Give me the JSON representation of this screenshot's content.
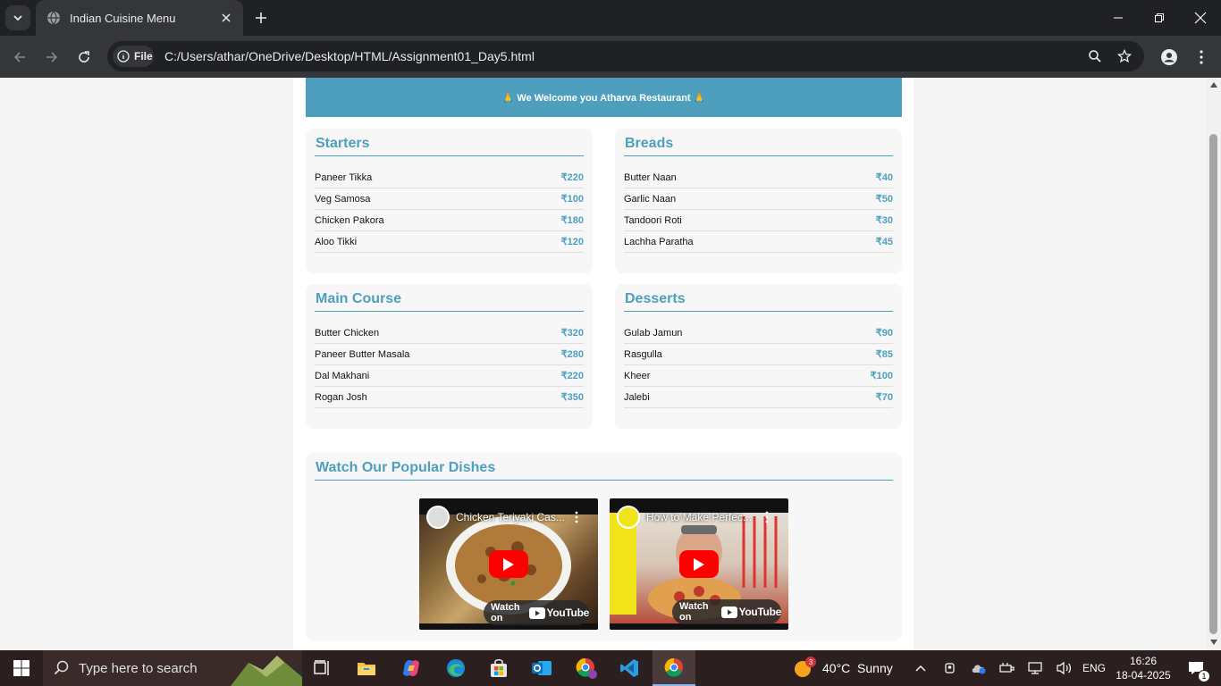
{
  "browser": {
    "tab_title": "Indian Cuisine Menu",
    "chip_label": "File",
    "url": "C:/Users/athar/OneDrive/Desktop/HTML/Assignment01_Day5.html"
  },
  "page": {
    "banner": "🙏 We Welcome you Atharva Restaurant 🙏",
    "sections": [
      {
        "title": "Starters",
        "items": [
          {
            "name": "Paneer Tikka",
            "price": "₹220"
          },
          {
            "name": "Veg Samosa",
            "price": "₹100"
          },
          {
            "name": "Chicken Pakora",
            "price": "₹180"
          },
          {
            "name": "Aloo Tikki",
            "price": "₹120"
          }
        ]
      },
      {
        "title": "Breads",
        "items": [
          {
            "name": "Butter Naan",
            "price": "₹40"
          },
          {
            "name": "Garlic Naan",
            "price": "₹50"
          },
          {
            "name": "Tandoori Roti",
            "price": "₹30"
          },
          {
            "name": "Lachha Paratha",
            "price": "₹45"
          }
        ]
      },
      {
        "title": "Main Course",
        "items": [
          {
            "name": "Butter Chicken",
            "price": "₹320"
          },
          {
            "name": "Paneer Butter Masala",
            "price": "₹280"
          },
          {
            "name": "Dal Makhani",
            "price": "₹220"
          },
          {
            "name": "Rogan Josh",
            "price": "₹350"
          }
        ]
      },
      {
        "title": "Desserts",
        "items": [
          {
            "name": "Gulab Jamun",
            "price": "₹90"
          },
          {
            "name": "Rasgulla",
            "price": "₹85"
          },
          {
            "name": "Kheer",
            "price": "₹100"
          },
          {
            "name": "Jalebi",
            "price": "₹70"
          }
        ]
      }
    ],
    "videos_title": "Watch Our Popular Dishes",
    "videos": [
      {
        "title": "Chicken Teriyaki Cas...",
        "watch_label": "Watch on",
        "logo": "YouTube"
      },
      {
        "title": "How to Make Perfec...",
        "watch_label": "Watch on",
        "logo": "YouTube"
      }
    ]
  },
  "taskbar": {
    "search_placeholder": "Type here to search",
    "weather": "40°C  Sunny",
    "weather_badge": "3",
    "language": "ENG",
    "time": "16:26",
    "date": "18-04-2025",
    "notification_count": "1"
  },
  "colors": {
    "accent": "#4e9fbd",
    "youtube_red": "#ff0000"
  }
}
